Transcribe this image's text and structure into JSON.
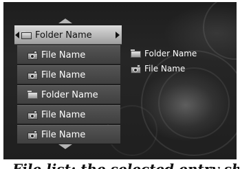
{
  "menu": {
    "items": [
      {
        "type": "folder",
        "label": "Folder Name",
        "selected": true
      },
      {
        "type": "file",
        "label": "File Name"
      },
      {
        "type": "file",
        "label": "File Name"
      },
      {
        "type": "folder",
        "label": "Folder Name"
      },
      {
        "type": "file",
        "label": "File Name"
      },
      {
        "type": "file",
        "label": "File Name"
      }
    ],
    "scroll_up_icon": "triangle-up-icon",
    "scroll_down_icon": "triangle-down-icon"
  },
  "preview": {
    "items": [
      {
        "type": "folder",
        "label": "Folder Name"
      },
      {
        "type": "file",
        "label": "File Name"
      }
    ]
  },
  "caption": {
    "text": "File list: the selected entry shows its contents"
  },
  "colors": {
    "background": "#1f1f1f",
    "selected_row": "#c8c8c8",
    "row": "#4a4a4a",
    "text": "#ffffff"
  }
}
